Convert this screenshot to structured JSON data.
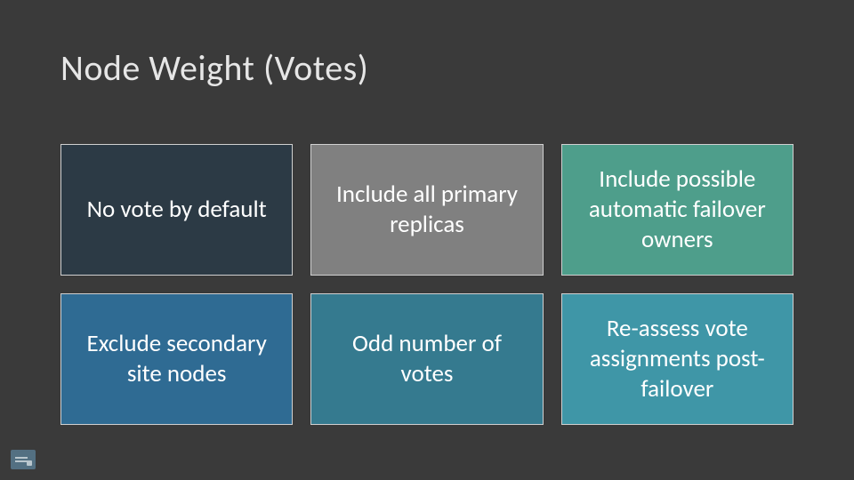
{
  "slide": {
    "title": "Node Weight (Votes)",
    "tiles": [
      {
        "label": "No vote by default",
        "colorClass": "c0"
      },
      {
        "label": "Include all primary replicas",
        "colorClass": "c1"
      },
      {
        "label": "Include possible automatic failover owners",
        "colorClass": "c2"
      },
      {
        "label": "Exclude secondary site nodes",
        "colorClass": "c3"
      },
      {
        "label": "Odd number of votes",
        "colorClass": "c4"
      },
      {
        "label": "Re-assess vote assignments post-failover",
        "colorClass": "c5"
      }
    ]
  }
}
